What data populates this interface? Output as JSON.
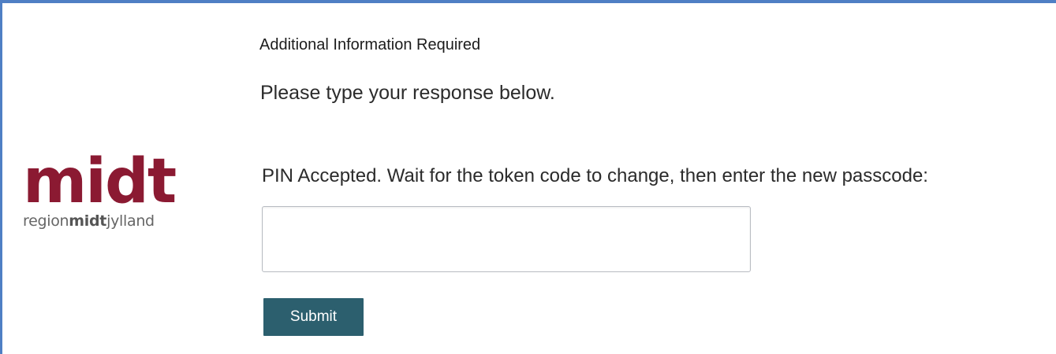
{
  "logo": {
    "word": "midt",
    "sub_prefix": "region",
    "sub_bold": "midt",
    "sub_suffix": "jylland",
    "brand_color": "#8b1a32"
  },
  "form": {
    "heading": "Additional Information Required",
    "prompt": "Please type your response below.",
    "instruction": "PIN Accepted. Wait for the token code to change, then enter the new passcode:",
    "input_value": "",
    "submit_label": "Submit",
    "submit_color": "#2c5f6e"
  },
  "frame": {
    "border_color": "#4f7fc4"
  }
}
